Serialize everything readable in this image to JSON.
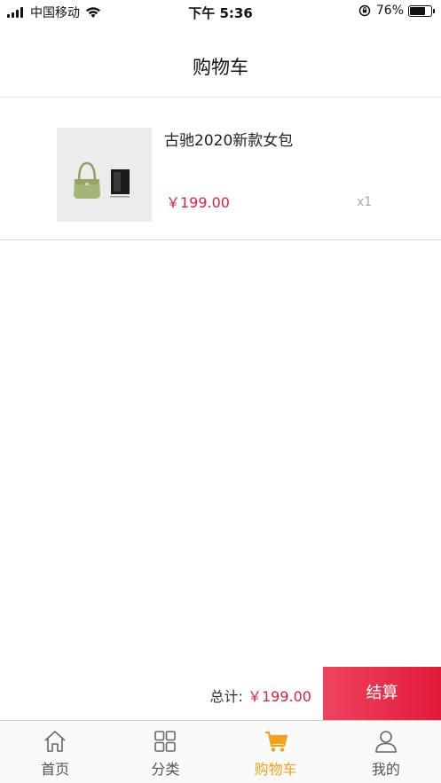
{
  "status_bar": {
    "carrier": "中国移动",
    "time": "下午 5:36",
    "battery": "76%",
    "battery_level": 0.76
  },
  "nav": {
    "title": "购物车"
  },
  "cart": {
    "items": [
      {
        "name": "古驰2020新款女包",
        "price": "￥199.00",
        "qty": "x1"
      }
    ]
  },
  "checkout": {
    "total_label": "总计:",
    "total_value": "￥199.00",
    "button_label": "结算",
    "accent": "#e41a3a"
  },
  "tabs": [
    {
      "label": "首页",
      "icon": "home-icon"
    },
    {
      "label": "分类",
      "icon": "grid-icon"
    },
    {
      "label": "购物车",
      "icon": "cart-icon",
      "active": true
    },
    {
      "label": "我的",
      "icon": "user-icon"
    }
  ],
  "colors": {
    "active_tab": "#f5a21b",
    "price": "#e0203a"
  }
}
